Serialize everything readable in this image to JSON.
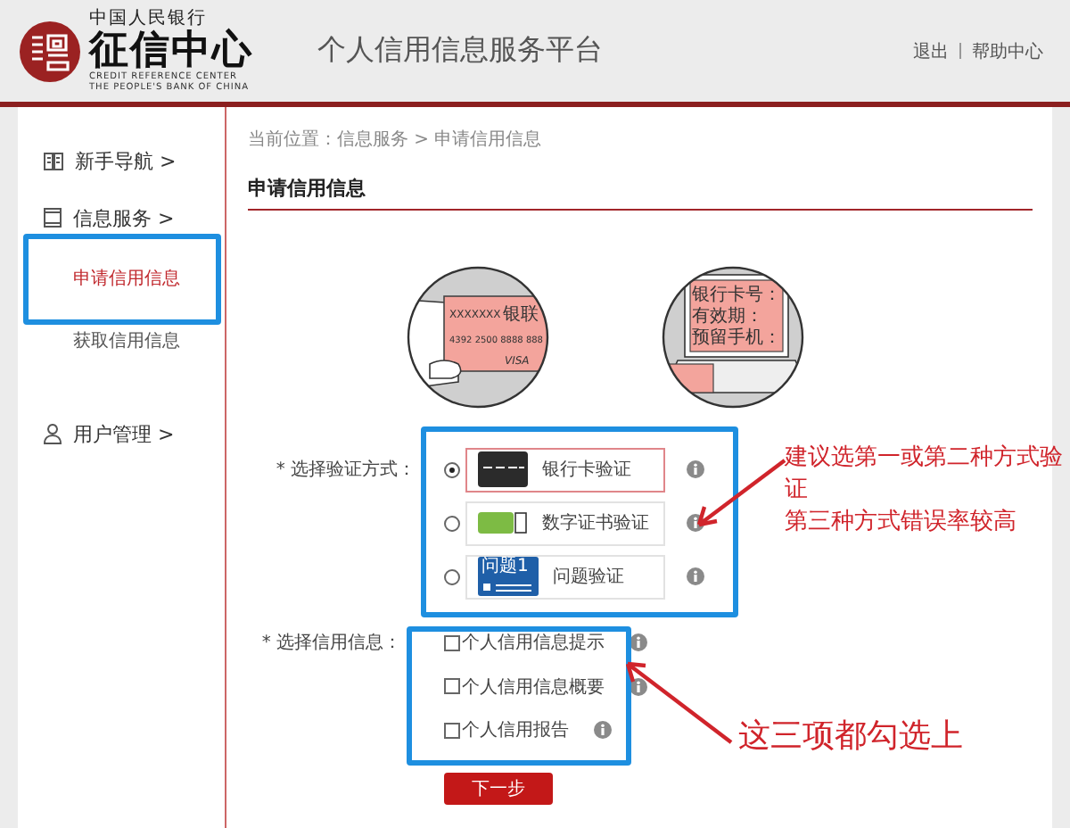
{
  "header": {
    "logo": {
      "top_line": "中国人民银行",
      "name": "征信中心",
      "english": [
        "CREDIT REFERENCE CENTER",
        "THE PEOPLE'S BANK OF CHINA"
      ]
    },
    "title": "个人信用信息服务平台",
    "links": [
      "退出",
      "帮助中心"
    ]
  },
  "sidebar": {
    "items": [
      {
        "label": "新手导航 >",
        "kind": "guide",
        "selected": false
      },
      {
        "label": "信息服务 >",
        "kind": "service",
        "selected": false
      },
      {
        "label": "申请信用信息",
        "kind": "page",
        "selected": true
      },
      {
        "label": "获取信用信息",
        "kind": "page",
        "selected": false
      },
      {
        "label": "用户管理 >",
        "kind": "user",
        "selected": false
      }
    ]
  },
  "breadcrumb": "当前位置：信息服务 > 申请信用信息",
  "heading": "申请信用信息",
  "illustrations": [
    {
      "kind": "card",
      "texts": [
        "XXXXXXX",
        "银联",
        "4392 2500 8888 888",
        "VISA"
      ]
    },
    {
      "kind": "laptop",
      "texts": [
        "银行卡号：",
        "有效期：",
        "预留手机："
      ]
    }
  ],
  "verification": {
    "label": "* 选择验证方式：",
    "options": [
      {
        "kind": "bank-card",
        "label": "银行卡验证",
        "selected": true
      },
      {
        "kind": "certificate",
        "label": "数字证书验证",
        "selected": false
      },
      {
        "kind": "question",
        "label": "问题验证",
        "selected": false,
        "badge": "问题1"
      }
    ]
  },
  "credit_info": {
    "label": "* 选择信用信息：",
    "options": [
      {
        "label": "个人信用信息提示",
        "checked": false
      },
      {
        "label": "个人信用信息概要",
        "checked": false
      },
      {
        "label": "个人信用报告",
        "checked": false
      }
    ]
  },
  "next_button": "下一步",
  "annotations": [
    {
      "kind": "method-note",
      "lines": [
        "建议选第一或第二种方式验证",
        "第三种方式错误率较高"
      ]
    },
    {
      "kind": "check-note",
      "lines": [
        "这三项都勾选上"
      ]
    }
  ]
}
